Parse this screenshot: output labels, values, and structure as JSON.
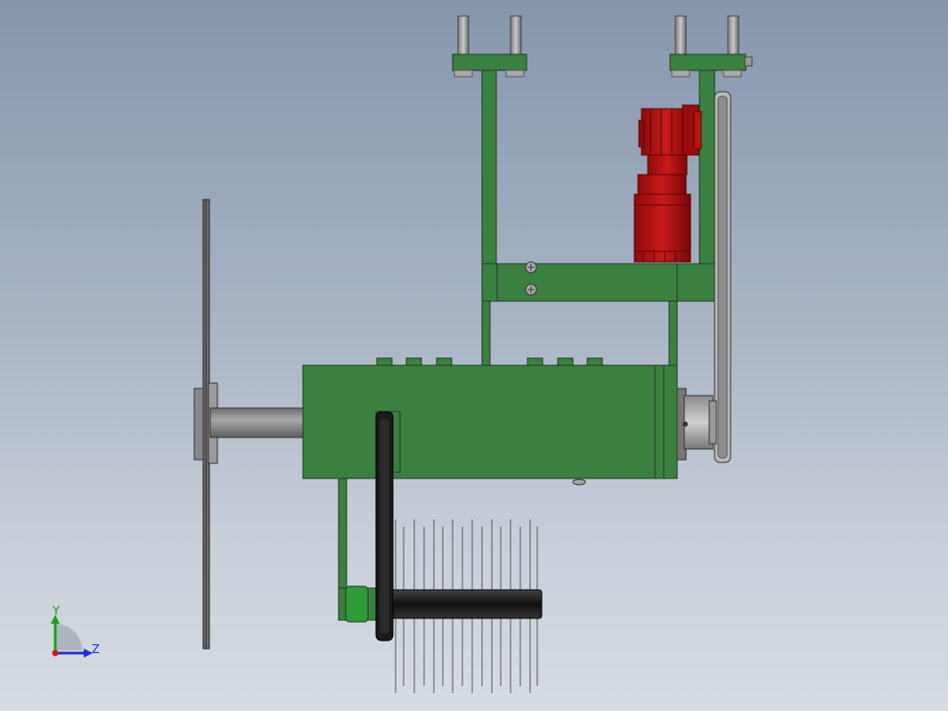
{
  "triad": {
    "y_label": "Y",
    "z_label": "Z",
    "y_color": "#1aa01a",
    "z_color": "#1e2fd6",
    "x_color": "#d01818"
  },
  "colors": {
    "frame_green": "#3a8040",
    "frame_stroke": "#1f3a1f",
    "motor_red": "#b01010",
    "motor_dark": "#7a0808",
    "steel": "#9a9a9a",
    "belt": "#1a1a1a",
    "brush_shaft": "#222222"
  }
}
